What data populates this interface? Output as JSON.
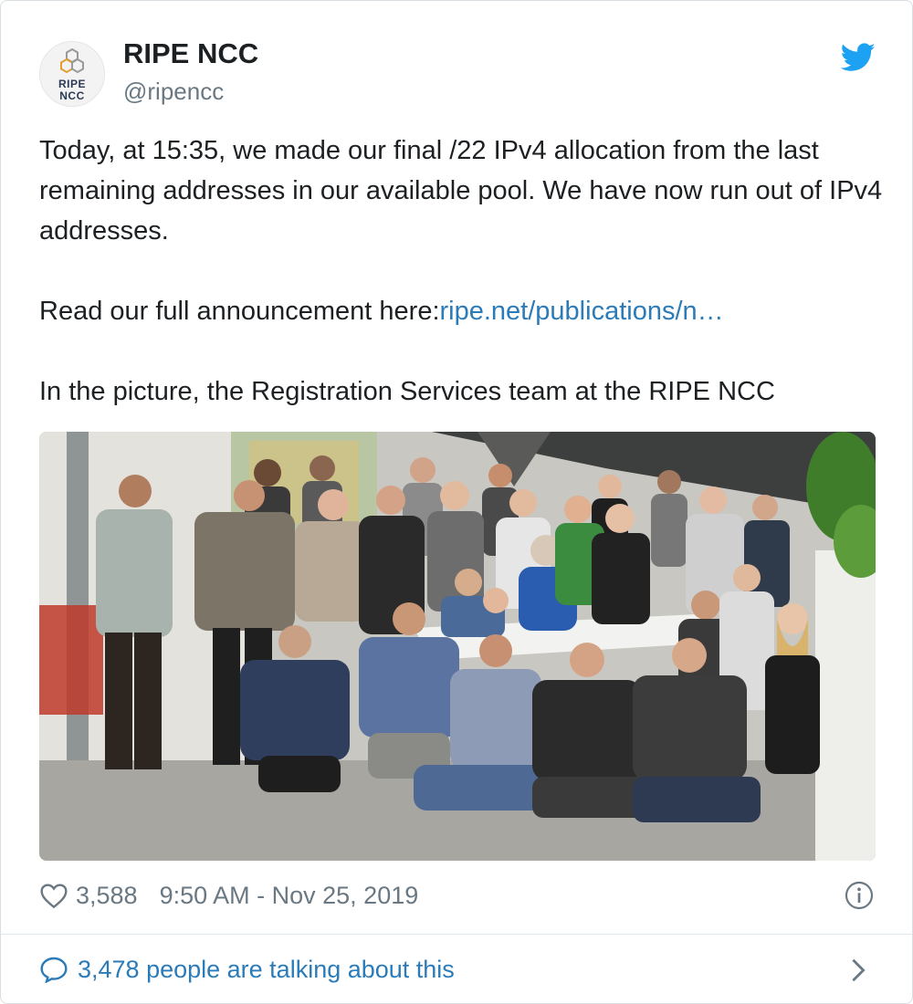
{
  "account": {
    "name": "RIPE NCC",
    "handle": "@ripencc",
    "avatar_line1": "RIPE",
    "avatar_line2": "NCC"
  },
  "tweet": {
    "paragraph1": "Today, at 15:35, we made our final /22 IPv4 allocation from the last remaining addresses in our available pool. We have now run out of IPv4 addresses.",
    "paragraph2_prefix": "Read our full announcement here:",
    "paragraph2_link": "ripe.net/publications/n…",
    "paragraph3": "In the picture, the Registration Services team at the RIPE NCC"
  },
  "meta": {
    "likes": "3,588",
    "timestamp": "9:50 AM - Nov 25, 2019"
  },
  "footer": {
    "talking_label": "3,478 people are talking about this"
  },
  "icons": {
    "brand": "twitter-bird-icon",
    "like": "heart-icon",
    "info": "info-icon",
    "reply": "speech-bubble-icon",
    "more": "chevron-right-icon"
  },
  "colors": {
    "link": "#2b7bb9",
    "twitter_blue": "#1da1f2",
    "muted": "#697882"
  }
}
